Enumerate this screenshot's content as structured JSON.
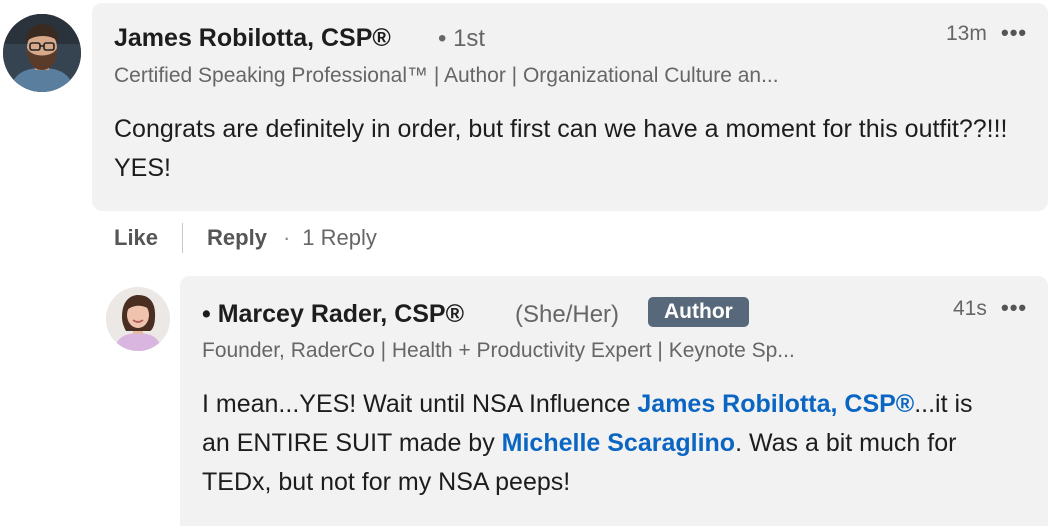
{
  "comments": [
    {
      "author": {
        "name": "James Robilotta, CSP®",
        "degree": "• 1st",
        "headline": "Certified Speaking Professional™ | Author | Organizational Culture an..."
      },
      "timestamp": "13m",
      "more_label": "•••",
      "text": "Congrats are definitely in order, but first can we have a moment for this outfit??!!! YES!",
      "actions": {
        "like": "Like",
        "reply": "Reply",
        "separator": "·",
        "reply_count": "1 Reply"
      }
    }
  ],
  "reply": {
    "author": {
      "name": "• Marcey Rader, CSP®",
      "pronouns": "(She/Her)",
      "badge": "Author",
      "headline": "Founder, RaderCo | Health + Productivity Expert | Keynote Sp..."
    },
    "timestamp": "41s",
    "more_label": "•••",
    "text": {
      "part1": "I mean...YES! Wait until NSA Influence ",
      "mention1": "James Robilotta, CSP®",
      "part2": "...it is an ENTIRE SUIT made by ",
      "mention2": "Michelle Scaraglino",
      "part3": ". Was a bit much for TEDx, but not for my NSA peeps!"
    }
  }
}
